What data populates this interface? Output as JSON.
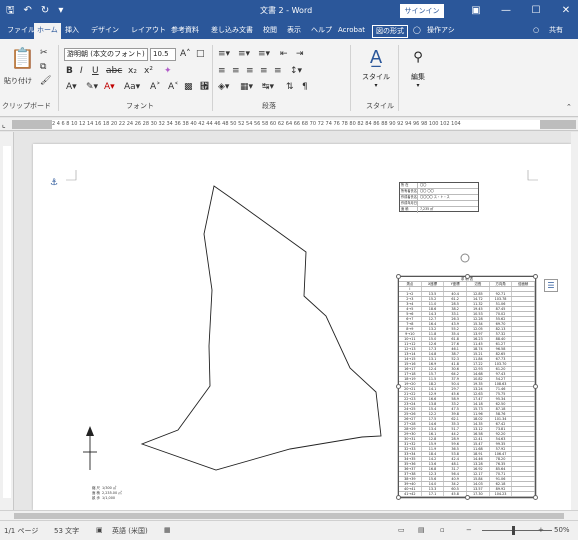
{
  "titlebar": {
    "title": "文書 2 - Word",
    "signin_label": "サインイン",
    "qat": [
      "save-icon",
      "undo-icon",
      "redo-icon",
      "customize-icon"
    ]
  },
  "tabs": [
    "ファイル",
    "ホーム",
    "挿入",
    "デザイン",
    "レイアウト",
    "参考資料",
    "差し込み文書",
    "校閲",
    "表示",
    "ヘルプ",
    "Acrobat",
    "図の形式"
  ],
  "tell_me": "操作アシ",
  "share": "共有",
  "ribbon": {
    "paste_label": "貼り付け",
    "clipboard_label": "クリップボード",
    "font_name": "游明朝 (本文のフォント)",
    "font_size": "10.5",
    "font_group_label": "フォント",
    "paragraph_label": "段落",
    "style_label": "スタイル",
    "style_group_label": "スタイル",
    "edit_label": "編集"
  },
  "ruler_text": "2  4  6  8  10 12 14 16 18 20 22 24 26 28 30 32 34 36 38 40 42 44 46 48 50 52 54 56 58 60 62 64 66 68 70 72 74 76 78 80 82 84 86 88 90 92 94 96 98 100 102 104",
  "vruler_numbers": [
    "2",
    "4",
    "6",
    "8",
    "10",
    "12",
    "14",
    "16",
    "18",
    "20",
    "22",
    "24",
    "26",
    "28"
  ],
  "drawing": {
    "info_rows": [
      {
        "k": "所  在",
        "v": "〇〇"
      },
      {
        "k": "所有者氏名",
        "v": "〇〇  〇〇"
      },
      {
        "k": "作成者氏名",
        "v": "〇〇〇〇  ス・ト・ス"
      },
      {
        "k": "作成年月日",
        "v": ""
      },
      {
        "k": "面  積",
        "v": "7,235 ㎡"
      }
    ],
    "table_title": "求  積  表",
    "table_headers": [
      "測点",
      "X座標",
      "Y座標",
      "辺長",
      "方向角",
      "倍面積"
    ],
    "table_rows": [
      [
        "Ⅰ",
        "",
        "",
        "",
        "",
        ""
      ],
      [
        "1→2",
        "13.5",
        "40.4",
        "12.85",
        "92.71",
        ""
      ],
      [
        "2→3",
        "15.2",
        "61.2",
        "14.72",
        "103.78",
        ""
      ],
      [
        "3→4",
        "11.0",
        "28.5",
        "11.32",
        "51.06",
        ""
      ],
      [
        "4→5",
        "18.6",
        "38.2",
        "19.45",
        "87.45",
        ""
      ],
      [
        "5→6",
        "14.3",
        "33.1",
        "10.53",
        "70.02",
        ""
      ],
      [
        "6→7",
        "12.7",
        "26.3",
        "12.28",
        "55.62",
        ""
      ],
      [
        "7→8",
        "16.4",
        "43.9",
        "15.34",
        "69.70",
        ""
      ],
      [
        "8→9",
        "13.2",
        "55.2",
        "12.05",
        "82.13",
        ""
      ],
      [
        "9→10",
        "11.8",
        "35.4",
        "13.97",
        "57.32",
        ""
      ],
      [
        "10→11",
        "15.0",
        "61.8",
        "16.23",
        "88.40",
        ""
      ],
      [
        "11→12",
        "12.6",
        "27.6",
        "11.45",
        "61.27",
        ""
      ],
      [
        "12→13",
        "17.3",
        "46.1",
        "18.74",
        "96.58",
        ""
      ],
      [
        "13→14",
        "14.8",
        "38.7",
        "15.21",
        "82.65",
        ""
      ],
      [
        "14→15",
        "13.1",
        "52.3",
        "11.84",
        "67.73",
        ""
      ],
      [
        "15→16",
        "16.9",
        "41.8",
        "17.22",
        "103.70",
        ""
      ],
      [
        "16→17",
        "12.4",
        "30.6",
        "12.93",
        "61.20",
        ""
      ],
      [
        "17→18",
        "15.7",
        "64.2",
        "14.68",
        "97.43",
        ""
      ],
      [
        "18→19",
        "11.5",
        "37.9",
        "10.82",
        "54.27",
        ""
      ],
      [
        "19→20",
        "18.2",
        "50.4",
        "19.35",
        "108.63",
        ""
      ],
      [
        "20→21",
        "14.1",
        "29.7",
        "13.24",
        "71.46",
        ""
      ],
      [
        "21→22",
        "12.9",
        "45.6",
        "12.63",
        "75.75",
        ""
      ],
      [
        "22→23",
        "16.6",
        "58.9",
        "17.47",
        "95.34",
        ""
      ],
      [
        "23→24",
        "13.8",
        "33.2",
        "14.18",
        "62.50",
        ""
      ],
      [
        "24→25",
        "15.4",
        "47.5",
        "15.73",
        "87.18",
        ""
      ],
      [
        "25→26",
        "12.2",
        "39.8",
        "11.96",
        "58.76",
        ""
      ],
      [
        "26→27",
        "17.5",
        "62.1",
        "18.02",
        "101.34",
        ""
      ],
      [
        "27→28",
        "14.6",
        "35.3",
        "14.35",
        "67.42",
        ""
      ],
      [
        "28→29",
        "13.4",
        "51.7",
        "13.12",
        "73.81",
        ""
      ],
      [
        "29→30",
        "16.1",
        "44.2",
        "16.58",
        "92.20",
        ""
      ],
      [
        "30→31",
        "12.8",
        "28.9",
        "12.41",
        "54.63",
        ""
      ],
      [
        "31→32",
        "15.9",
        "59.6",
        "15.47",
        "99.35",
        ""
      ],
      [
        "32→33",
        "11.9",
        "36.5",
        "11.68",
        "57.92",
        ""
      ],
      [
        "33→34",
        "18.4",
        "53.8",
        "18.91",
        "106.47",
        ""
      ],
      [
        "34→35",
        "14.2",
        "42.4",
        "14.46",
        "78.20",
        ""
      ],
      [
        "35→36",
        "13.6",
        "48.1",
        "13.28",
        "76.35",
        ""
      ],
      [
        "36→37",
        "16.8",
        "31.7",
        "16.92",
        "85.64",
        ""
      ],
      [
        "37→38",
        "12.3",
        "56.4",
        "12.17",
        "70.71",
        ""
      ],
      [
        "38→39",
        "15.6",
        "40.9",
        "15.84",
        "91.06",
        ""
      ],
      [
        "39→40",
        "14.0",
        "34.2",
        "14.03",
        "62.18",
        ""
      ],
      [
        "40→41",
        "13.3",
        "60.5",
        "13.57",
        "89.92",
        ""
      ],
      [
        "41→42",
        "17.1",
        "45.8",
        "17.30",
        "104.23",
        ""
      ],
      [
        "合  計",
        "",
        "",
        "",
        "",
        "14,470.00"
      ]
    ],
    "legend": [
      {
        "k": "縮  尺",
        "v": "1/300 ㎡"
      },
      {
        "k": "面  積",
        "v": "2,235.00 ㎡"
      },
      {
        "k": "畝  歩",
        "v": "1/1,000"
      }
    ]
  },
  "status": {
    "page": "1/1 ページ",
    "words": "53 文字",
    "language": "英語 (米国)",
    "zoom": "50%"
  }
}
